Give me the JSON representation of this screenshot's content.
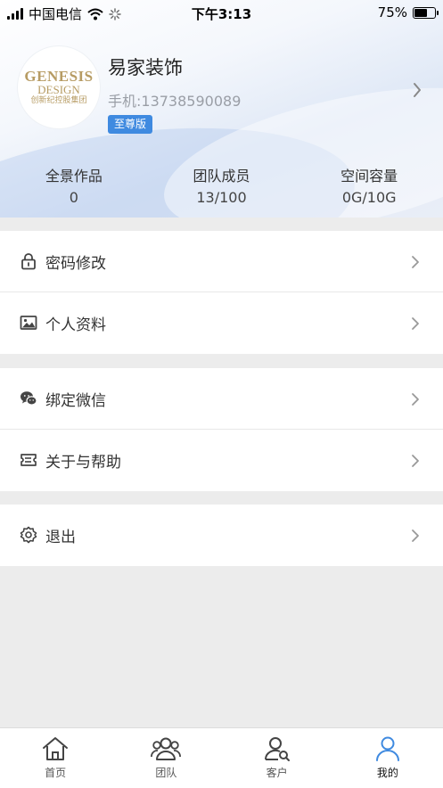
{
  "status_bar": {
    "carrier": "中国电信",
    "time": "下午3:13",
    "battery": "75%",
    "battery_level": 0.75
  },
  "profile": {
    "logo_lines": [
      "GENESIS",
      "DESIGN",
      "创新纪控股集团"
    ],
    "name": "易家装饰",
    "phone": "手机:13738590089",
    "tier_badge": "至尊版"
  },
  "stats": [
    {
      "label": "全景作品",
      "value": "0"
    },
    {
      "label": "团队成员",
      "value": "13/100"
    },
    {
      "label": "空间容量",
      "value": "0G/10G"
    }
  ],
  "menu": {
    "password": "密码修改",
    "profile": "个人资料",
    "wechat": "绑定微信",
    "about": "关于与帮助",
    "logout": "退出"
  },
  "tabs": [
    {
      "label": "首页",
      "icon": "home-icon"
    },
    {
      "label": "团队",
      "icon": "team-icon"
    },
    {
      "label": "客户",
      "icon": "customer-icon"
    },
    {
      "label": "我的",
      "icon": "user-icon",
      "active": true
    }
  ],
  "colors": {
    "accent": "#3f8ae0",
    "active_tab": "#3f8ae0",
    "page_bg": "#ececec"
  }
}
